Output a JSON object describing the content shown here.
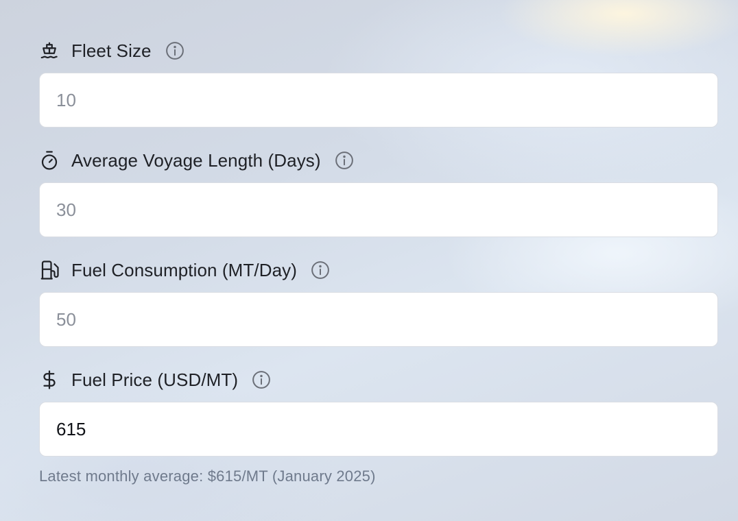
{
  "fields": [
    {
      "icon": "ship-icon",
      "label": "Fleet Size",
      "placeholder": "10",
      "value": ""
    },
    {
      "icon": "timer-icon",
      "label": "Average Voyage Length (Days)",
      "placeholder": "30",
      "value": ""
    },
    {
      "icon": "fuel-pump-icon",
      "label": "Fuel Consumption (MT/Day)",
      "placeholder": "50",
      "value": ""
    },
    {
      "icon": "dollar-icon",
      "label": "Fuel Price (USD/MT)",
      "placeholder": "",
      "value": "615"
    }
  ],
  "fuel_price_hint": "Latest monthly average: $615/MT (January 2025)",
  "colors": {
    "text": "#1f2126",
    "icon": "#1f2126",
    "info_icon": "#6b6f78",
    "placeholder": "#8a8f99",
    "hint": "#6f7a8c",
    "input_border": "#dadde3"
  }
}
